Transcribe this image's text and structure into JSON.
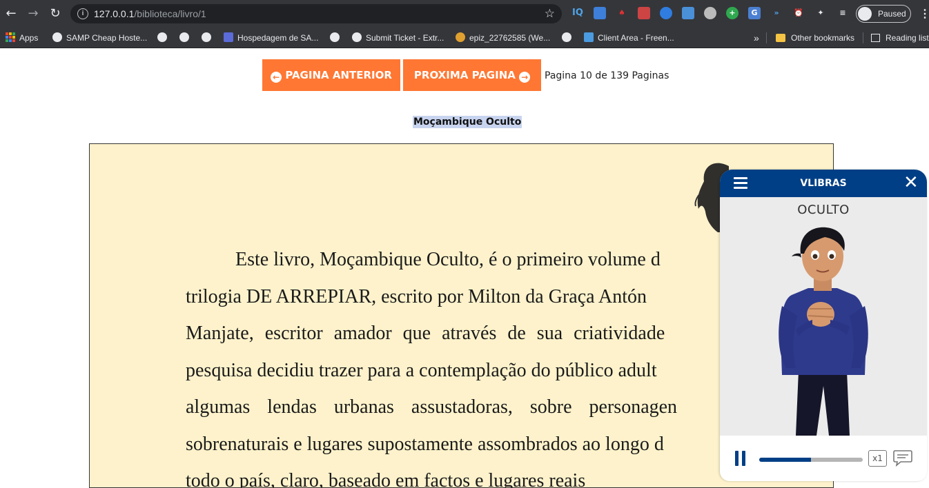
{
  "browser": {
    "url_host": "127.0.0.1",
    "url_path": "/biblioteca/livro/1",
    "profile_status": "Paused",
    "extensions": [
      "IQ",
      "",
      "",
      "",
      "",
      "",
      "",
      "",
      "",
      "",
      "",
      "",
      "",
      "",
      ""
    ]
  },
  "bookmarks": {
    "items": [
      {
        "label": "Apps"
      },
      {
        "label": "SAMP Cheap Hoste..."
      },
      {
        "label": ""
      },
      {
        "label": ""
      },
      {
        "label": "Hospedagem de SA..."
      },
      {
        "label": ""
      },
      {
        "label": "Submit Ticket - Extr..."
      },
      {
        "label": "epiz_22762585 (We..."
      },
      {
        "label": ""
      },
      {
        "label": "Client Area - Freen..."
      }
    ],
    "more": "»",
    "other": "Other bookmarks",
    "reading": "Reading list"
  },
  "pager": {
    "prev_label": "PAGINA ANTERIOR",
    "next_label": "PROXIMA PAGINA",
    "count_text": "Pagina 10 de 139 Paginas",
    "current_page": 10,
    "total_pages": 139
  },
  "book": {
    "title": "Moçambique Oculto",
    "lines": [
      "Este livro, Moçambique Oculto, é o primeiro volume d",
      "trilogia DE ARREPIAR, escrito por Milton da Graça Antón",
      "Manjate, escritor amador que através de sua criatividade",
      "pesquisa decidiu trazer para a contemplação do público adult",
      "algumas lendas urbanas assustadoras, sobre personagen",
      "sobrenaturais e lugares supostamente assombrados ao longo d",
      "todo o país, claro, baseado em factos e lugares reais"
    ]
  },
  "vlibras": {
    "title": "VLIBRAS",
    "gloss": "OCULTO",
    "speed": "x1",
    "progress": 0.5,
    "accent": "#003f86"
  },
  "colors": {
    "button": "#ff7733",
    "page_bg": "#fdf2cb",
    "highlight": "#c8d4ef"
  }
}
